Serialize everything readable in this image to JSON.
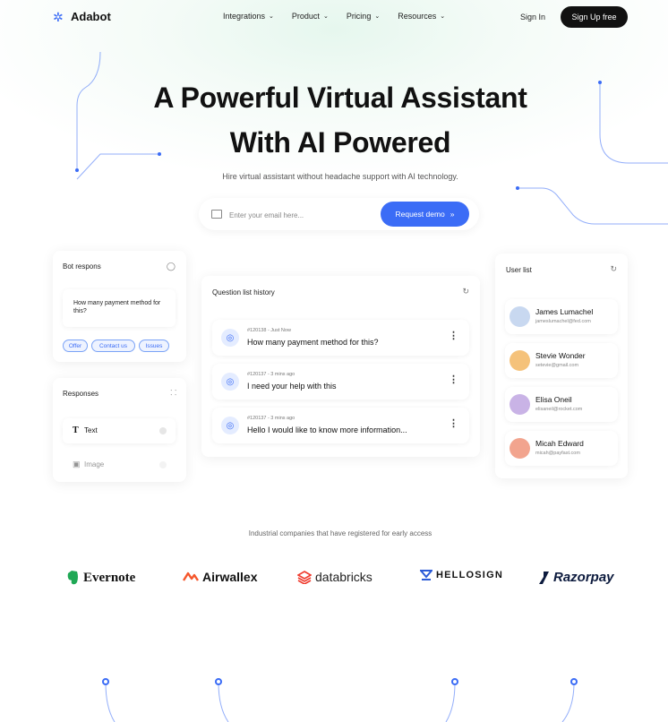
{
  "brand": {
    "name": "Adabot",
    "logo_icon": "sparkle-icon",
    "accent": "#3b6cf6"
  },
  "nav": {
    "items": [
      {
        "label": "Integrations"
      },
      {
        "label": "Product"
      },
      {
        "label": "Pricing"
      },
      {
        "label": "Resources"
      }
    ],
    "signin_label": "Sign In",
    "signup_label": "Sign Up free"
  },
  "hero": {
    "title_line1": "A Powerful Virtual Assistant",
    "title_line2": "With AI Powered",
    "subtitle": "Hire virtual assistant without headache support with AI technology.",
    "email_placeholder": "Enter your email here...",
    "cta_label": "Request demo",
    "cta_icon": "»"
  },
  "bot_card": {
    "title": "Bot respons",
    "message": "How many payment method for this?",
    "tags": [
      "Offer",
      "Contact us",
      "Issues"
    ]
  },
  "responses_card": {
    "title": "Responses",
    "items": [
      {
        "icon": "T",
        "label": "Text"
      },
      {
        "icon": "▣",
        "label": "Image"
      }
    ]
  },
  "question_card": {
    "title": "Question list history",
    "items": [
      {
        "meta": "#120138 - Just Now",
        "text": "How many payment method for this?"
      },
      {
        "meta": "#120137 - 3 mins ago",
        "text": "I need your help with this"
      },
      {
        "meta": "#120137 - 3 mins ago",
        "text": "Hello I would like to know more information..."
      }
    ]
  },
  "user_card": {
    "title": "User list",
    "users": [
      {
        "name": "James Lumachel",
        "email": "jameslumachel@fed.com",
        "avatar_color": "#c8d8f0"
      },
      {
        "name": "Stevie Wonder",
        "email": "setevie@gmail.com",
        "avatar_color": "#f5c27a"
      },
      {
        "name": "Elisa Oneil",
        "email": "elisaneil@rocket.com",
        "avatar_color": "#c9b3e6"
      },
      {
        "name": "Micah Edward",
        "email": "micah@payfast.com",
        "avatar_color": "#f2a48e"
      }
    ]
  },
  "partners": {
    "caption": "Industrial companies that have registered for early access",
    "logos": [
      "Evernote",
      "Airwallex",
      "databricks",
      "HELLOSIGN",
      "Razorpay"
    ]
  }
}
